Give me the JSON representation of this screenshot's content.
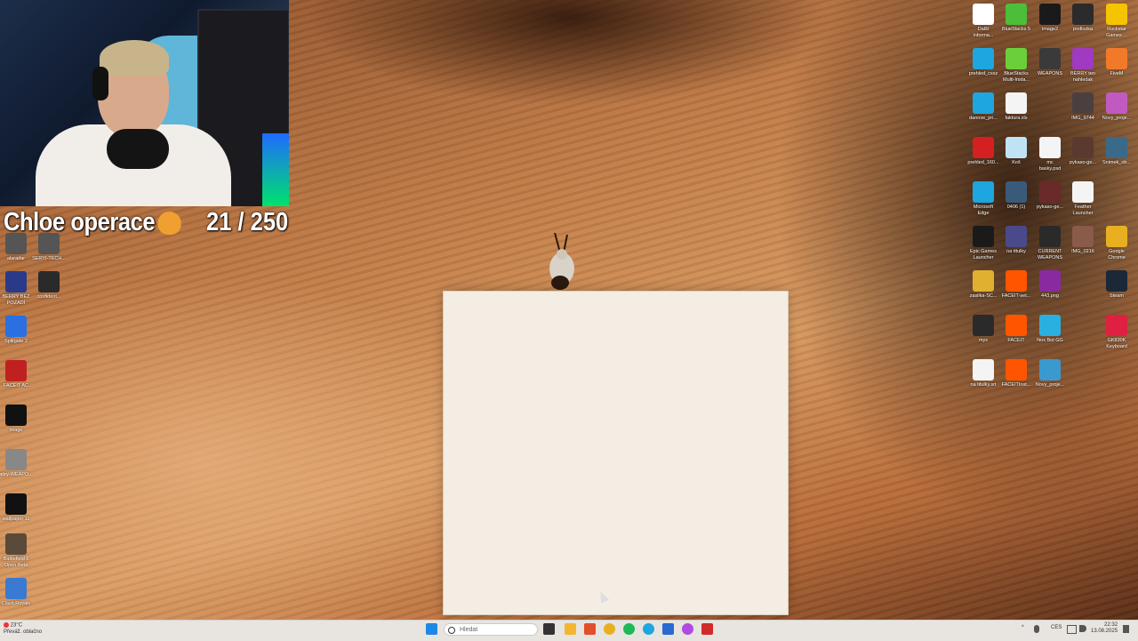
{
  "overlay": {
    "title": "Chloe operace",
    "counter": "21 / 250"
  },
  "desktop_right": [
    {
      "label": "Další\ninforma...",
      "color": "#ffffff",
      "icon": "info-icon"
    },
    {
      "label": "BlueStacks 5",
      "color": "#4bbf3a",
      "icon": "bluestacks-icon"
    },
    {
      "label": "image2",
      "color": "#1a1a1a",
      "icon": "image-file-icon"
    },
    {
      "label": "podlozka",
      "color": "#2b2b2b",
      "icon": "image-file-icon"
    },
    {
      "label": "Rockstar\nGames ...",
      "color": "#f5c400",
      "icon": "rockstar-icon"
    },
    {
      "label": "prehled_cssz",
      "color": "#1ea6e0",
      "icon": "edge-icon"
    },
    {
      "label": "BlueStacks\nMulti-Insta...",
      "color": "#6bcf3a",
      "icon": "bluestacks-icon"
    },
    {
      "label": "WEAPONS",
      "color": "#3a3a3a",
      "icon": "image-file-icon"
    },
    {
      "label": "BERRY ten\nnahledak",
      "color": "#a03ac0",
      "icon": "image-file-icon"
    },
    {
      "label": "FiveM",
      "color": "#f07a2a",
      "icon": "fivem-icon"
    },
    {
      "label": "danove_pri...",
      "color": "#1ea6e0",
      "icon": "edge-icon"
    },
    {
      "label": "faktura.xls",
      "color": "#f4f4f4",
      "icon": "document-icon"
    },
    {
      "label": "",
      "color": "transparent",
      "icon": ""
    },
    {
      "label": "IMG_9744",
      "color": "#4a4040",
      "icon": "image-file-icon"
    },
    {
      "label": "Novy_proje...",
      "color": "#c05ac0",
      "icon": "image-file-icon"
    },
    {
      "label": "prehled_160...",
      "color": "#d42020",
      "icon": "pdf-icon"
    },
    {
      "label": "Koš",
      "color": "#bfe3f5",
      "icon": "recycle-bin-icon"
    },
    {
      "label": "mc\nbasky.psd",
      "color": "#f4f4f4",
      "icon": "document-icon"
    },
    {
      "label": "pykaso-ge...",
      "color": "#5a3a30",
      "icon": "image-file-icon"
    },
    {
      "label": "Snimek_ob...",
      "color": "#3a6a8a",
      "icon": "image-file-icon"
    },
    {
      "label": "Microsoft\nEdge",
      "color": "#1ea6e0",
      "icon": "edge-icon"
    },
    {
      "label": "0406 (1)",
      "color": "#3a5a7a",
      "icon": "image-file-icon"
    },
    {
      "label": "pykaso-ge...",
      "color": "#6a2a2a",
      "icon": "image-file-icon"
    },
    {
      "label": "Feather\nLauncher",
      "color": "#f4f4f4",
      "icon": "feather-icon"
    },
    {
      "label": "",
      "color": "transparent",
      "icon": ""
    },
    {
      "label": "Epic Games\nLauncher",
      "color": "#1a1a1a",
      "icon": "epic-games-icon"
    },
    {
      "label": "na titulky",
      "color": "#4a4a8a",
      "icon": "image-file-icon"
    },
    {
      "label": "CURRENT\nWEAPONS",
      "color": "#2a2a2a",
      "icon": "image-file-icon"
    },
    {
      "label": "IMG_0216",
      "color": "#8a5a4a",
      "icon": "image-file-icon"
    },
    {
      "label": "Google\nChrome",
      "color": "#e8b020",
      "icon": "chrome-icon"
    },
    {
      "label": "zasilka-SC...",
      "color": "#e0b030",
      "icon": "folder-icon"
    },
    {
      "label": "FACEIT-set...",
      "color": "#ff5500",
      "icon": "faceit-icon"
    },
    {
      "label": "443.png",
      "color": "#8a2aa0",
      "icon": "image-file-icon"
    },
    {
      "label": "",
      "color": "transparent",
      "icon": ""
    },
    {
      "label": "Steam",
      "color": "#1b2838",
      "icon": "steam-icon"
    },
    {
      "label": "mys",
      "color": "#2a2a2a",
      "icon": "image-file-icon"
    },
    {
      "label": "FACEIT",
      "color": "#ff5500",
      "icon": "faceit-icon"
    },
    {
      "label": "Nox Bot GG",
      "color": "#2ab0e0",
      "icon": "app-icon"
    },
    {
      "label": "",
      "color": "transparent",
      "icon": ""
    },
    {
      "label": "GK830K\nKeyboard",
      "color": "#e02040",
      "icon": "keyboard-app-icon"
    },
    {
      "label": "na titulky.srt",
      "color": "#f4f4f4",
      "icon": "document-icon"
    },
    {
      "label": "FACEITInst...",
      "color": "#ff5500",
      "icon": "faceit-icon"
    },
    {
      "label": "Novy_proje...",
      "color": "#3a9ad0",
      "icon": "image-file-icon"
    }
  ],
  "desktop_left": [
    {
      "label": "alaradar",
      "color": "#555555",
      "icon": "app-icon"
    },
    {
      "label": "SERYI-TECH...",
      "color": "#555555",
      "icon": "app-icon"
    },
    {
      "label": "BERRY BEZ\nPOZADÍ",
      "color": "#2a3a8a",
      "icon": "image-file-icon"
    },
    {
      "label": "confident...",
      "color": "#2a2a2a",
      "icon": "image-file-icon"
    },
    {
      "label": "Splitgate 2",
      "color": "#2a70e0",
      "icon": "splitgate-icon"
    },
    {
      "label": "FACEIT AC",
      "color": "#c02020",
      "icon": "faceit-icon"
    },
    {
      "label": "image",
      "color": "#111111",
      "icon": "image-file-icon"
    },
    {
      "label": "attry-WEAPO...",
      "color": "#888888",
      "icon": "image-file-icon"
    },
    {
      "label": "wallpaper 11",
      "color": "#111111",
      "icon": "image-file-icon"
    },
    {
      "label": "Battlefield 6\nOpen Beta",
      "color": "#5a4a3a",
      "icon": "battlefield-icon"
    },
    {
      "label": "Clash Royale",
      "color": "#3a7ad0",
      "icon": "clash-royale-icon"
    }
  ],
  "taskbar": {
    "weather_temp": "23°C",
    "weather_desc": "Převáž. oblačno",
    "search_placeholder": "Hledat",
    "language": "CES",
    "time": "22:32",
    "date": "13.08.2025"
  },
  "taskbar_apps": [
    {
      "name": "start-button",
      "color": "#1e88e5"
    },
    {
      "name": "task-view-icon",
      "color": "#333333"
    },
    {
      "name": "file-explorer-icon",
      "color": "#f2b632"
    },
    {
      "name": "app-icon",
      "color": "#e0502a"
    },
    {
      "name": "chrome-icon",
      "color": "#e8b020"
    },
    {
      "name": "spotify-icon",
      "color": "#1db954"
    },
    {
      "name": "edge-icon",
      "color": "#1ea6e0"
    },
    {
      "name": "app-icon",
      "color": "#2a6ad0"
    },
    {
      "name": "messenger-icon",
      "color": "#b04ae0"
    },
    {
      "name": "app-icon",
      "color": "#d02a2a"
    }
  ]
}
